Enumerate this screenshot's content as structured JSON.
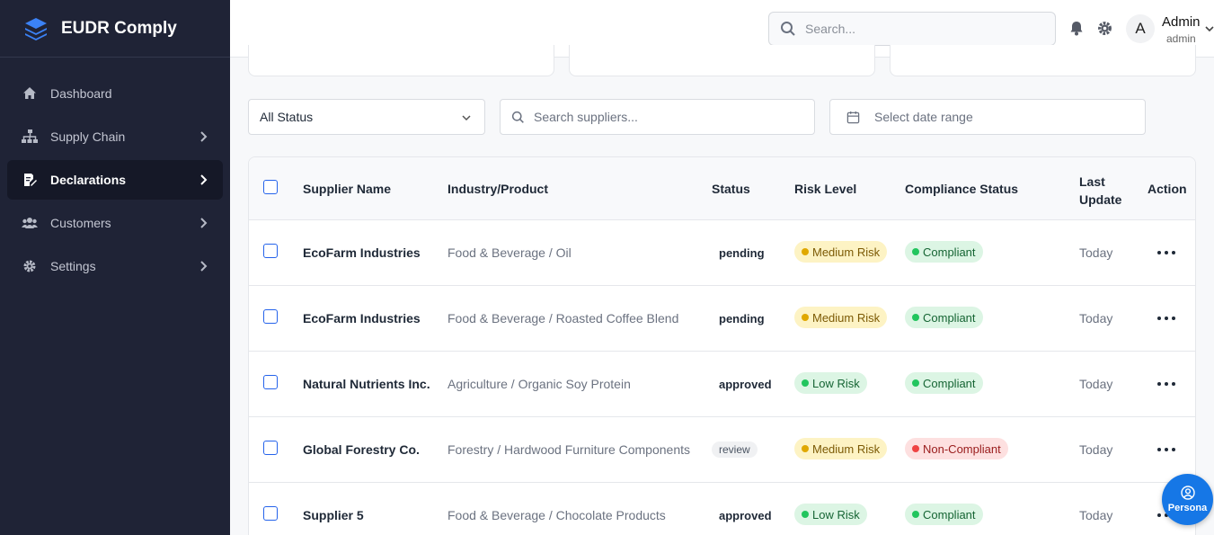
{
  "app": {
    "brand_name": "EUDR Comply",
    "accent": "#1677e6",
    "sidebar_bg": "#1f2336"
  },
  "sidebar": {
    "items": [
      {
        "label": "Dashboard",
        "icon": "home-icon",
        "has_chevron": false,
        "active": false
      },
      {
        "label": "Supply Chain",
        "icon": "sitemap-icon",
        "has_chevron": true,
        "active": false
      },
      {
        "label": "Declarations",
        "icon": "document-edit-icon",
        "has_chevron": true,
        "active": true
      },
      {
        "label": "Customers",
        "icon": "users-icon",
        "has_chevron": true,
        "active": false
      },
      {
        "label": "Settings",
        "icon": "gear-icon",
        "has_chevron": true,
        "active": false
      }
    ]
  },
  "header": {
    "search_placeholder": "Search...",
    "avatar_initial": "A",
    "user_name": "Admin",
    "user_role": "admin"
  },
  "filters": {
    "status_value": "All Status",
    "supplier_search_placeholder": "Search suppliers...",
    "date_range_placeholder": "Select date range"
  },
  "table": {
    "columns": {
      "supplier": "Supplier Name",
      "industry": "Industry/Product",
      "status": "Status",
      "risk": "Risk Level",
      "compliance": "Compliance Status",
      "last_update": "Last Update",
      "action": "Action"
    },
    "rows": [
      {
        "supplier": "EcoFarm Industries",
        "industry": "Food & Beverage / Oil",
        "status": "pending",
        "risk": "Medium Risk",
        "risk_level": "medium",
        "compliance": "Compliant",
        "compliance_level": "compliant",
        "last_update": "Today"
      },
      {
        "supplier": "EcoFarm Industries",
        "industry": "Food & Beverage / Roasted Coffee Blend",
        "status": "pending",
        "risk": "Medium Risk",
        "risk_level": "medium",
        "compliance": "Compliant",
        "compliance_level": "compliant",
        "last_update": "Today"
      },
      {
        "supplier": "Natural Nutrients Inc.",
        "industry": "Agriculture / Organic Soy Protein",
        "status": "approved",
        "risk": "Low Risk",
        "risk_level": "low",
        "compliance": "Compliant",
        "compliance_level": "compliant",
        "last_update": "Today"
      },
      {
        "supplier": "Global Forestry Co.",
        "industry": "Forestry / Hardwood Furniture Components",
        "status": "review",
        "risk": "Medium Risk",
        "risk_level": "medium",
        "compliance": "Non-Compliant",
        "compliance_level": "noncompliant",
        "last_update": "Today"
      },
      {
        "supplier": "Supplier 5",
        "industry": "Food & Beverage / Chocolate Products",
        "status": "approved",
        "risk": "Low Risk",
        "risk_level": "low",
        "compliance": "Compliant",
        "compliance_level": "compliant",
        "last_update": "Today"
      }
    ]
  },
  "fab": {
    "label": "Persona",
    "icon": "user-circle-icon"
  }
}
